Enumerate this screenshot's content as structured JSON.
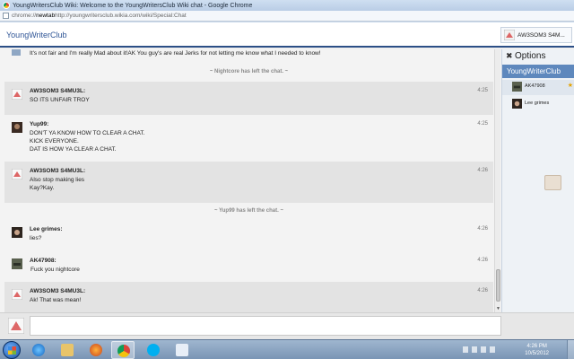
{
  "window": {
    "title": "YoungWritersClub Wiki: Welcome to the YoungWritersClub Wiki chat - Google Chrome"
  },
  "address_bar": {
    "scheme": "chrome://",
    "host": "newtab",
    "path": "http://youngwritersclub.wikia.com/wiki/Special:Chat"
  },
  "header": {
    "site_name": "YoungWriterClub",
    "current_user": "AW3SOM3 S4M..."
  },
  "chat": {
    "top_partial_line": "It's not fair and I'm really Mad about it!AK You guy's are real Jerks for not letting me know what I needed to know!",
    "notice_1": "~ Nightcore has left the chat. ~",
    "notice_2": "~ Yup99 has left the chat. ~",
    "messages": [
      {
        "sender": "AW3SOM3 S4MU3L:",
        "time": "4:25",
        "lines": [
          "SO ITS UNFAIR TROY"
        ]
      },
      {
        "sender": "Yup99:",
        "time": "4:25",
        "lines": [
          "DON'T YA KNOW HOW TO CLEAR A CHAT.",
          "KICK EVERYONE.",
          "DAT IS HOW YA CLEAR A CHAT."
        ]
      },
      {
        "sender": "AW3SOM3 S4MU3L:",
        "time": "4:26",
        "lines": [
          "Also stop making lies",
          "Kay?Kay."
        ]
      },
      {
        "sender": "Lee grimes:",
        "time": "4:26",
        "lines": [
          "lies?"
        ]
      },
      {
        "sender": "AK47908:",
        "time": "4:26",
        "lines": [
          "Fuck you nightcore"
        ]
      },
      {
        "sender": "AW3SOM3 S4MU3L:",
        "time": "4:26",
        "lines": [
          "Ak! That was mean!"
        ]
      }
    ]
  },
  "rail": {
    "options_label": "Options",
    "room_title": "YoungWriterClub",
    "users": [
      {
        "name": "AK47908",
        "starred": "★"
      },
      {
        "name": "Lee grimes",
        "starred": ""
      }
    ]
  },
  "taskbar": {
    "time": "4:26 PM",
    "date": "10/5/2012"
  },
  "colors": {
    "header_border": "#2c4f86",
    "rail_title_bg": "#5e88bd",
    "message_shade": "#e3e3e3"
  }
}
